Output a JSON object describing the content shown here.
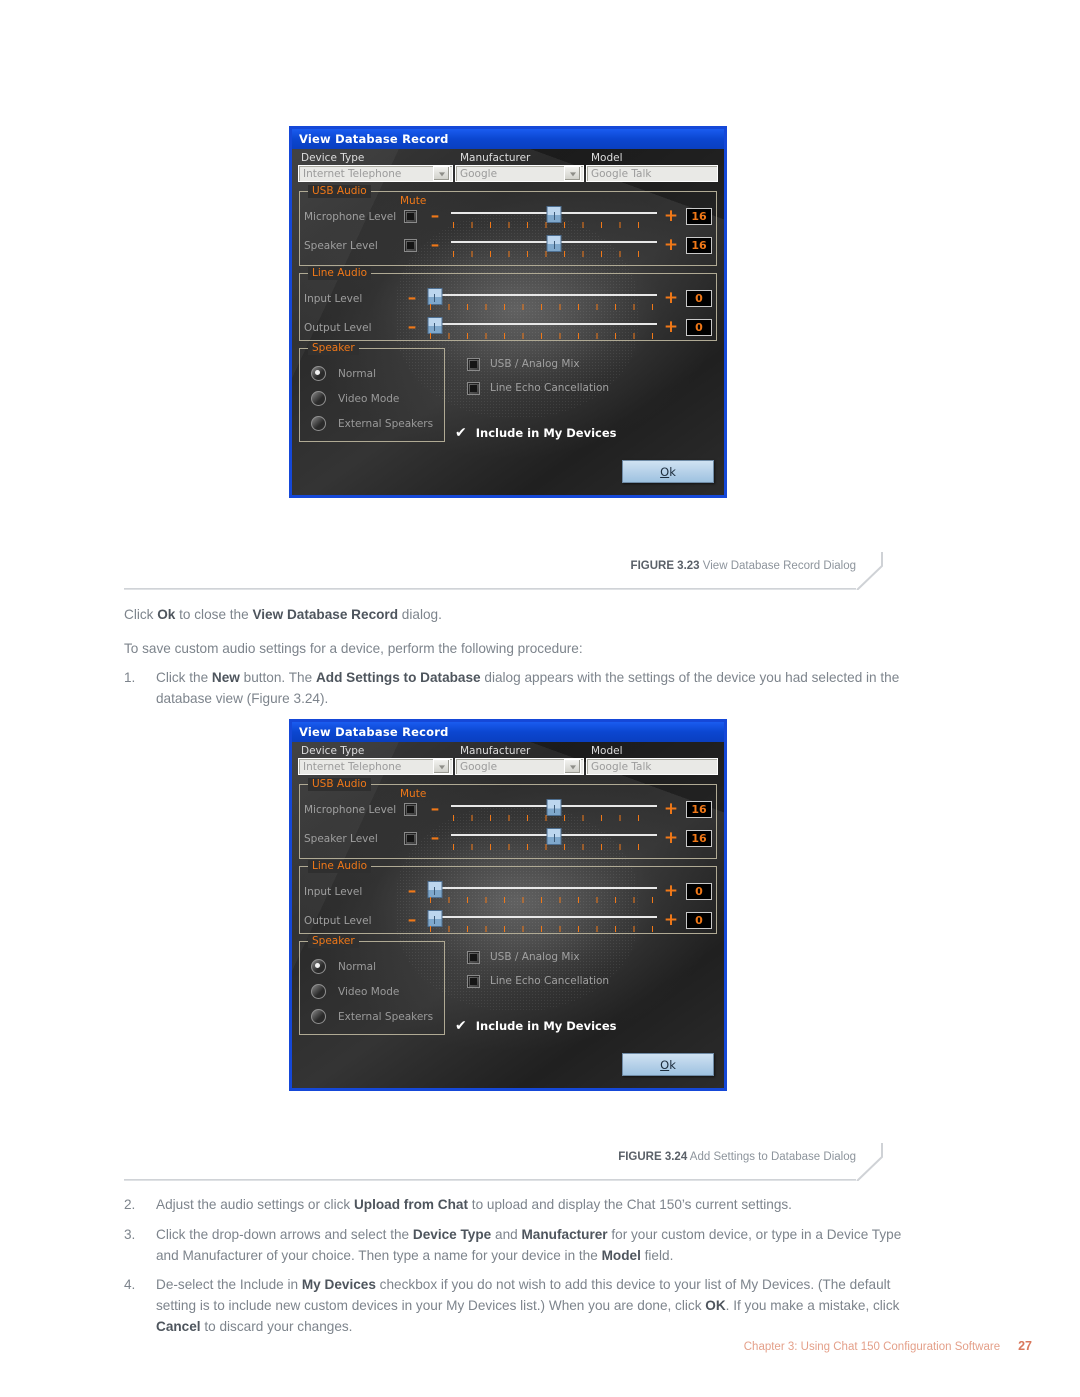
{
  "page": {
    "background": "#ffffff",
    "footer_text": "Chapter 3: Using Chat 150 Configuration Software",
    "page_number": "27",
    "footer_color": "#e4a08a"
  },
  "dialog": {
    "title": "View Database Record",
    "title_bar_color": "#0b46d0",
    "border_color": "#1548d8",
    "accent_color": "#f07818",
    "fields": {
      "device_type_label": "Device Type",
      "device_type_value": "Internet  Telephone",
      "manufacturer_label": "Manufacturer",
      "manufacturer_value": "Google",
      "model_label": "Model",
      "model_value": "Google Talk"
    },
    "usb_audio": {
      "legend": "USB Audio",
      "mute_label": "Mute",
      "rows": [
        {
          "name": "Microphone Level",
          "value": "16",
          "thumb_pct": 50,
          "minus": "–",
          "plus": "+"
        },
        {
          "name": "Speaker Level",
          "value": "16",
          "thumb_pct": 50,
          "minus": "–",
          "plus": "+"
        }
      ]
    },
    "line_audio": {
      "legend": "Line Audio",
      "rows": [
        {
          "name": "Input Level",
          "value": "0",
          "thumb_pct": 3,
          "minus": "–",
          "plus": "+"
        },
        {
          "name": "Output Level",
          "value": "0",
          "thumb_pct": 3,
          "minus": "–",
          "plus": "+"
        }
      ]
    },
    "speaker": {
      "legend": "Speaker",
      "options": [
        {
          "label": "Normal",
          "selected": true
        },
        {
          "label": "Video Mode",
          "selected": false
        },
        {
          "label": "External Speakers",
          "selected": false
        }
      ]
    },
    "checkboxes": [
      {
        "label": "USB / Analog Mix",
        "checked": false
      },
      {
        "label": "Line Echo Cancellation",
        "checked": false
      }
    ],
    "include_in_my_devices": {
      "label": "Include in My Devices",
      "checked": true,
      "check_glyph": "✔"
    },
    "ok_button": {
      "label_pre": "O",
      "label_post": "k",
      "full_label": "Ok"
    }
  },
  "figures": [
    {
      "number": "FIGURE 3.23",
      "title": "View Database Record Dialog"
    },
    {
      "number": "FIGURE 3.24",
      "title": "Add Settings to Database Dialog"
    }
  ],
  "body": {
    "para_click_ok": {
      "p1": "Click ",
      "b1": "Ok",
      "p2": " to close the ",
      "b2": "View Database Record",
      "p3": " dialog."
    },
    "para_intro": "To save custom audio settings for a device, perform the following procedure:",
    "step1": {
      "num": "1.",
      "p1": "Click the ",
      "b1": "New",
      "p2": " button. The ",
      "b2": "Add Settings to Database",
      "p3": " dialog appears with the settings of the device you had selected in the database view (Figure 3.24)."
    },
    "step2": {
      "num": "2.",
      "p1": "Adjust the audio settings or click ",
      "b1": "Upload from Chat",
      "p2": " to upload and display the Chat 150’s current settings."
    },
    "step3": {
      "num": "3.",
      "p1": "Click the drop-down arrows and select the ",
      "b1": "Device Type",
      "p2": " and ",
      "b2": "Manufacturer",
      "p3": " for your custom device, or type in a Device Type and Manufacturer of your choice. Then type a name for your device in the ",
      "b3": "Model",
      "p4": " field."
    },
    "step4": {
      "num": "4.",
      "p1": "De-select the Include in ",
      "b1": "My Devices",
      "p2": " checkbox if you do not wish to add this device to your list of My Devices. (The default setting is to include new custom devices in your My Devices list.) When you are done, click ",
      "b2": "OK",
      "p3": ". If you make a mistake, click ",
      "b3": "Cancel",
      "p4": " to discard your changes."
    }
  }
}
